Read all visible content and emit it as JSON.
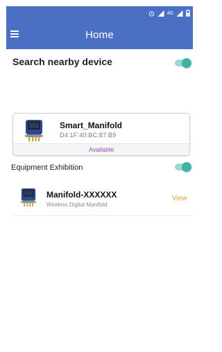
{
  "status_bar": {
    "icons": [
      "alarm-icon",
      "signal-icon",
      "network-4g-icon",
      "signal-icon",
      "battery-icon"
    ],
    "network_label": "4G"
  },
  "header": {
    "title": "Home"
  },
  "search_section": {
    "title": "Search nearby device",
    "toggle_on": true
  },
  "nearby_devices": [
    {
      "name": "Smart_Manifold",
      "mac": "D4:1F:40:BC:87:B9",
      "status": "Available"
    }
  ],
  "exhibition_section": {
    "title": "Equipment Exhibition",
    "toggle_on": true
  },
  "equipment": [
    {
      "name": "Manifold-XXXXXX",
      "description": "Wireless Digital Manifold",
      "action_label": "View"
    }
  ],
  "colors": {
    "header_bg": "#4a6fc3",
    "toggle_knob": "#3db5a5",
    "toggle_track": "#9fd8d0",
    "status_text": "#9b4fb3",
    "view_link": "#e0a32f"
  }
}
